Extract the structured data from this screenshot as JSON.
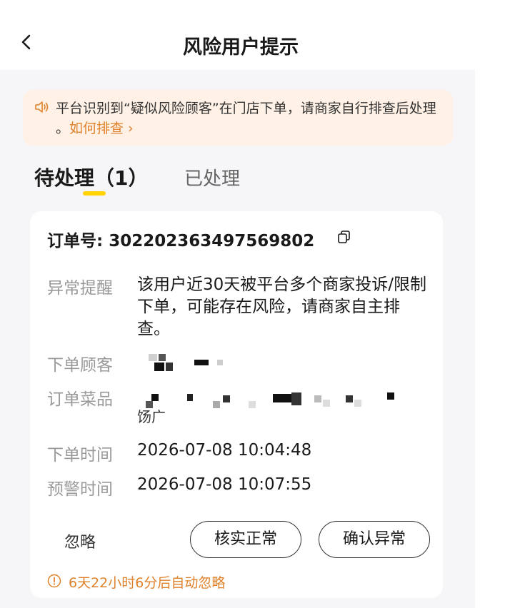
{
  "nav": {
    "title": "风险用户提示"
  },
  "notice": {
    "text": "平台识别到“疑似风险顾客”在门店下单，请商家自行排查后处理 。",
    "link": "如何排查 ›"
  },
  "tabs": {
    "pending": "待处理（1）",
    "processed": "已处理"
  },
  "order": {
    "label": "订单号: 3022023634975698​02",
    "number_display": "订单号: 3022023634975698​02",
    "warning_label": "异常提醒",
    "warning_text": "该用户近30天被平台多个商家投诉/限制下单，可能存在风险，请商家自主排查。",
    "customer_label": "下单顾客",
    "items_label": "订单菜品",
    "items_tail": "饧广",
    "order_time_label": "下单时间",
    "order_time": "2026-07-08 10:04:48",
    "alert_time_label": "预警时间",
    "alert_time": "2026-07-08 10:07:55"
  },
  "actions": {
    "ignore": "忽略",
    "confirm_normal": "核实正常",
    "confirm_abnormal": "确认异常"
  },
  "countdown": "6天22小时6分后自动忽略",
  "colors": {
    "accent": "#e0822c",
    "tab_underline": "#ffd400",
    "notice_bg": "#fff1e6",
    "page_bg": "#f6f6f8"
  }
}
